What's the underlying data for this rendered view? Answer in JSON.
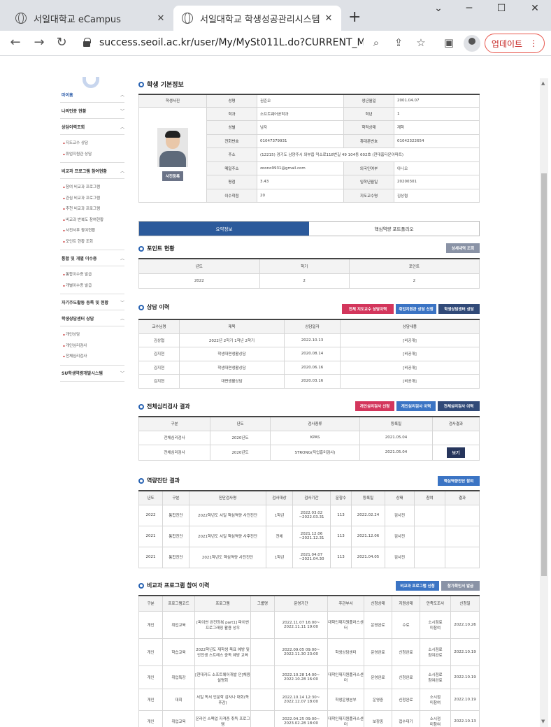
{
  "browser": {
    "tabs": [
      {
        "title": "서일대학교 eCampus"
      },
      {
        "title": "서일대학교 학생성공관리시스템"
      }
    ],
    "url": "success.seoil.ac.kr/user/My/MySt011L.do?CURRENT_MEN...",
    "update_label": "업데이트"
  },
  "sidebar": {
    "items": [
      {
        "label": "마이홈",
        "open": true
      },
      {
        "label": "나의인증 현황"
      },
      {
        "label": "상담이력조회",
        "sub": [
          "지도교수 상담",
          "취업지원관 상담"
        ]
      },
      {
        "label": "비교과 프로그램 참여현황",
        "sub": [
          "참여 비교과 프로그램",
          "관심 비교과 프로그램",
          "추천 비교과 프로그램",
          "비교과 반복도 참여현황",
          "사전사후 참여현황",
          "포인트 현황 조회"
        ]
      },
      {
        "label": "통합 및 개별 이수증",
        "sub": [
          "통합이수증 발급",
          "개별이수증 발급"
        ]
      },
      {
        "label": "자기주도활동 등록 및 현황"
      },
      {
        "label": "학생상담센터 상담",
        "sub": [
          "개인상담",
          "개인심리검사",
          "전체심리검사"
        ]
      },
      {
        "label": "SU학생역량개발시스템"
      }
    ]
  },
  "profile": {
    "section_title": "학생 기본정보",
    "photo_label": "학생사진",
    "photo_button": "사진등록",
    "rows": [
      [
        "성명",
        "권준오",
        "생년월일",
        "2001.04.07"
      ],
      [
        "학과",
        "소프트웨어공학과",
        "학년",
        "1"
      ],
      [
        "성별",
        "남자",
        "학적상태",
        "재학"
      ],
      [
        "전화번호",
        "01047379931",
        "휴대폰번호",
        "01042322654"
      ],
      [
        "주소",
        "(12215) 경기도 남양주시 와부읍 덕소로118번길 49 104동 602호 (현대홈타운아파트)"
      ],
      [
        "메일주소",
        "zoono9931@gmail.com",
        "외국인여부",
        "아니오"
      ],
      [
        "평점",
        "3.43",
        "입학년월일",
        "20200301"
      ],
      [
        "이수학점",
        "20",
        "지도교수명",
        "김상협"
      ]
    ]
  },
  "tabs": [
    "요약정보",
    "핵심역량 포트폴리오"
  ],
  "points": {
    "title": "포인트 현황",
    "button": "상세내역 조회",
    "headers": [
      "년도",
      "학기",
      "포인트"
    ],
    "rows": [
      [
        "2022",
        "2",
        "2"
      ]
    ]
  },
  "counsel": {
    "title": "상담 이력",
    "buttons": [
      "전체 지도교수 상담이력",
      "취업지원관 상담 신청",
      "학생상담센터 상담"
    ],
    "headers": [
      "교수님명",
      "제목",
      "상담일자",
      "상담내용"
    ],
    "rows": [
      [
        "김상협",
        "2022년 2학기 1학년 2학기",
        "2022.10.13",
        "[비공개]"
      ],
      [
        "김지현",
        "학생대면생활상담",
        "2020.08.14",
        "[비공개]"
      ],
      [
        "김지현",
        "학생대면생활상담",
        "2020.06.16",
        "[비공개]"
      ],
      [
        "김지현",
        "대면생활상담",
        "2020.03.16",
        "[비공개]"
      ]
    ]
  },
  "psych": {
    "title": "전체심리검사 결과",
    "buttons": [
      "개인심리검사 신청",
      "개인심리검사 이력",
      "전체심리검사 이력"
    ],
    "headers": [
      "구분",
      "년도",
      "검사종류",
      "등록일",
      "검사결과"
    ],
    "rows": [
      [
        "전체심리검사",
        "2020년도",
        "KPAS",
        "2021.05.04",
        ""
      ],
      [
        "전체심리검사",
        "2020년도",
        "STRONG(직업흥미검사)",
        "2021.05.04",
        "보기"
      ]
    ]
  },
  "competency": {
    "title": "역량진단 결과",
    "button": "핵심역량진단 참여",
    "headers": [
      "년도",
      "구분",
      "진단검사명",
      "검사대상",
      "검사기간",
      "문항수",
      "등록일",
      "상태",
      "참여",
      "결과"
    ],
    "rows": [
      [
        "2022",
        "통합진단",
        "2022학년도 서일 핵심역량 사전진단",
        "1학년",
        "2022.03.02\n~2022.03.31",
        "113",
        "2022.02.24",
        "검사전",
        "",
        ""
      ],
      [
        "2021",
        "통합진단",
        "2021학년도 서일 핵심역량 사후진단",
        "전체",
        "2021.12.06\n~2021.12.31",
        "113",
        "2021.12.06",
        "검사전",
        "",
        ""
      ],
      [
        "2021",
        "통합진단",
        "2021학년도 핵심역량 사전진단",
        "1학년",
        "2021.04.07\n~2021.04.30",
        "113",
        "2021.04.05",
        "검사전",
        "",
        ""
      ]
    ]
  },
  "program": {
    "title": "비교과 프로그램 참여 이력",
    "buttons": [
      "비교과 프로그램 신청",
      "참가확인서 발급"
    ],
    "headers": [
      "구분",
      "프로그램코드",
      "프로그램",
      "그룹명",
      "운영기간",
      "주관부서",
      "신청상태",
      "지원상태",
      "만족도조사",
      "신청일"
    ],
    "rows": [
      [
        "개인",
        "취업교육",
        "[파이썬 완전정복 part1] 파이썬 프로그래밍 활용 성우",
        "",
        "2022.11.07 16:00~\n2022.11.11 19:00",
        "대학인재지원플러스센터",
        "운영완료",
        "수료",
        "소시점료\n미참여",
        "2022.10.26"
      ],
      [
        "개인",
        "학습교육",
        "2022학년도 재학생 목표 예방 및 안전생 스트레스 중독 예방 교육",
        "",
        "2022.09.05 09:00~\n2022.11.30 23:00",
        "학생상담센터",
        "운영완료",
        "신청완료",
        "소시점료\n참여완료",
        "2022.10.19"
      ],
      [
        "개인",
        "취업특강",
        "[현대카드 소프트웨어개발 인]채용설명회",
        "",
        "2022.10.28 14:00~\n2022.10.28 16:00",
        "대학인재지원플러스센터",
        "운영완료",
        "신청완료",
        "소시점료\n참여완료",
        "2022.10.19"
      ],
      [
        "개인",
        "대회",
        "서일 독서 인문학 감사나 대회(독후감)",
        "",
        "2022.10.14 12:30~\n2022.12.07 18:00",
        "학생운영본부",
        "운영중",
        "신청완료",
        "소시점\n미참여",
        "2022.10.19"
      ],
      [
        "개인",
        "취업교육",
        "온라인 스펙업 자격증 취득 프로그램",
        "",
        "2022.04.25 09:00~\n2023.02.28 18:00",
        "대학인재지원플러스센터",
        "보장중",
        "접수대기",
        "소시점\n미참여",
        "2022.10.13"
      ]
    ]
  }
}
